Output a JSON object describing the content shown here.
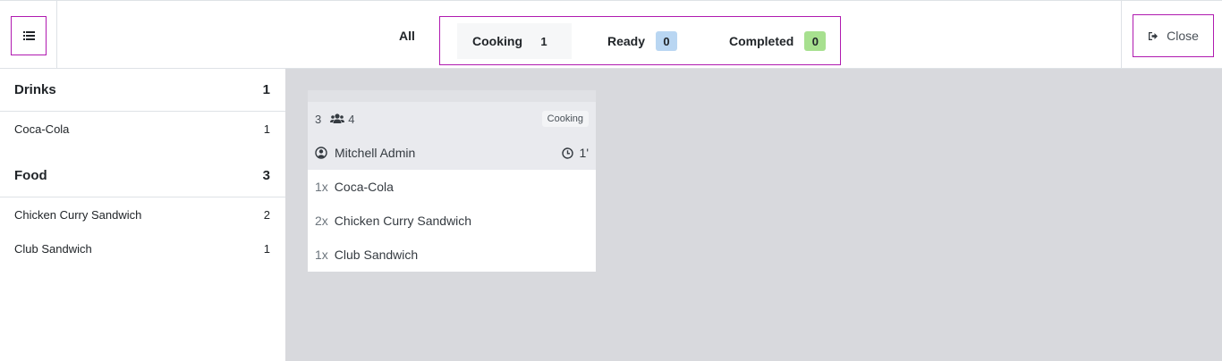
{
  "colors": {
    "accent_outline": "#b01ab0",
    "ready_badge": "#b9d6f2",
    "completed_badge": "#a7e08f",
    "main_bg": "#d8d9dd"
  },
  "header": {
    "tabs": {
      "all": "All",
      "cooking": {
        "label": "Cooking",
        "count": "1"
      },
      "ready": {
        "label": "Ready",
        "count": "0"
      },
      "completed": {
        "label": "Completed",
        "count": "0"
      }
    },
    "close_label": "Close",
    "icons": {
      "menu": "list-icon",
      "close": "sign-out-icon"
    }
  },
  "sidebar": {
    "categories": [
      {
        "name": "Drinks",
        "count": "1",
        "items": [
          {
            "name": "Coca-Cola",
            "count": "1"
          }
        ]
      },
      {
        "name": "Food",
        "count": "3",
        "items": [
          {
            "name": "Chicken Curry Sandwich",
            "count": "2"
          },
          {
            "name": "Club Sandwich",
            "count": "1"
          }
        ]
      }
    ]
  },
  "order": {
    "number": "3",
    "guests": "4",
    "status": "Cooking",
    "user": "Mitchell Admin",
    "elapsed": "1'",
    "lines": [
      {
        "qty": "1x",
        "name": "Coca-Cola"
      },
      {
        "qty": "2x",
        "name": "Chicken Curry Sandwich"
      },
      {
        "qty": "1x",
        "name": "Club Sandwich"
      }
    ]
  }
}
